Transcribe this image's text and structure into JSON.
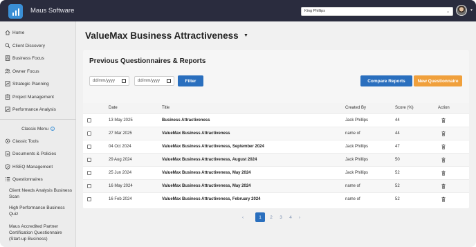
{
  "app": {
    "brand": "Maus Software"
  },
  "header": {
    "user_selected": "King Phillips"
  },
  "sidebar": {
    "items": [
      {
        "label": "Home",
        "icon": "home-icon"
      },
      {
        "label": "Client Discovery",
        "icon": "search-icon"
      },
      {
        "label": "Business Focus",
        "icon": "calculator-icon"
      },
      {
        "label": "Owner Focus",
        "icon": "users-icon"
      },
      {
        "label": "Strategic Planning",
        "icon": "plan-icon"
      },
      {
        "label": "Project Management",
        "icon": "clipboard-icon"
      },
      {
        "label": "Performance Analysis",
        "icon": "chart-icon"
      }
    ],
    "classic_menu_label": "Classic Menu",
    "classic_items": [
      {
        "label": "Classic Tools",
        "icon": "gear-icon"
      },
      {
        "label": "Documents & Policies",
        "icon": "document-icon"
      },
      {
        "label": "HSEQ Management",
        "icon": "shield-icon"
      },
      {
        "label": "Questionnaires",
        "icon": "list-icon"
      }
    ],
    "sub_items": [
      "Client Needs Analysis Business Scan",
      "High Performance Business Quiz",
      "Maus Accredited Partner Certification Questionnaire (Start-up Business)"
    ]
  },
  "main": {
    "page_title": "ValueMax Business Attractiveness",
    "section_title": "Previous Questionnaires & Reports",
    "date_from_placeholder": "dd/mm/yyyy",
    "date_to_placeholder": "dd/mm/yyyy",
    "filter_label": "Filter",
    "compare_label": "Compare Reports",
    "new_label": "New Questionnaire"
  },
  "table": {
    "headers": {
      "date": "Date",
      "title": "Title",
      "created_by": "Created By",
      "score": "Score (%)",
      "action": "Action"
    },
    "rows": [
      {
        "date": "13 May 2025",
        "title": "Business Attractiveness",
        "created_by": "Jack Phillips",
        "score": "44"
      },
      {
        "date": "27 Mar 2025",
        "title": "ValueMax Business Attractiveness",
        "created_by": "name of",
        "score": "44"
      },
      {
        "date": "04 Oct 2024",
        "title": "ValueMax Business Attractiveness, September 2024",
        "created_by": "Jack Phillips",
        "score": "47"
      },
      {
        "date": "29 Aug 2024",
        "title": "ValueMax Business Attractiveness, August 2024",
        "created_by": "Jack Phillips",
        "score": "50"
      },
      {
        "date": "25 Jun 2024",
        "title": "ValueMax Business Attractiveness, May 2024",
        "created_by": "Jack Phillips",
        "score": "52"
      },
      {
        "date": "16 May 2024",
        "title": "ValueMax Business Attractiveness, May 2024",
        "created_by": "name of",
        "score": "52"
      },
      {
        "date": "16 Feb 2024",
        "title": "ValueMax Business Attractiveness, February 2024",
        "created_by": "name of",
        "score": "52"
      }
    ]
  },
  "pagination": {
    "prev": "‹",
    "pages": [
      "1",
      "2",
      "3",
      "4"
    ],
    "next": "›",
    "current": "1"
  },
  "colors": {
    "topbar": "#2a2c3e",
    "primary": "#2a6fbe",
    "accent": "#f0a03c"
  }
}
